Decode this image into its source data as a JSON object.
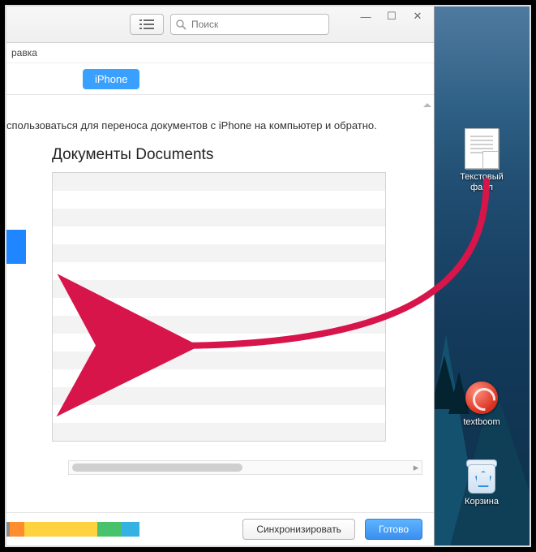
{
  "window": {
    "controls": {
      "min": "—",
      "max": "☐",
      "close": "✕"
    },
    "search_placeholder": "Поиск",
    "menubar_item": "равка",
    "device_pill": "iPhone"
  },
  "content": {
    "description": "спользоваться для переноса документов с iPhone на компьютер и обратно.",
    "section_title": "Документы Documents"
  },
  "footer": {
    "sync_label": "Синхронизировать",
    "done_label": "Готово"
  },
  "desktop": {
    "file_label": "Текстовый файл",
    "app_label": "textboom",
    "bin_label": "Корзина"
  }
}
